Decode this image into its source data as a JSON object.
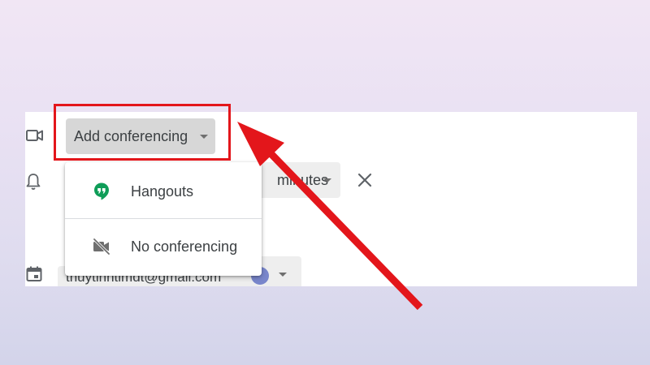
{
  "conferencing": {
    "button_label": "Add conferencing",
    "options": [
      {
        "label": "Hangouts",
        "icon": "hangouts-icon"
      },
      {
        "label": "No conferencing",
        "icon": "video-off-icon"
      }
    ]
  },
  "notification": {
    "unit_label": "minutes"
  },
  "calendar": {
    "owner_email": "thuytinhtimdt@gmail.com"
  },
  "colors": {
    "highlight": "#e3161b",
    "hangouts_green": "#0f9d58",
    "event_color": "#7986cb",
    "button_bg": "#d7d7d7"
  }
}
